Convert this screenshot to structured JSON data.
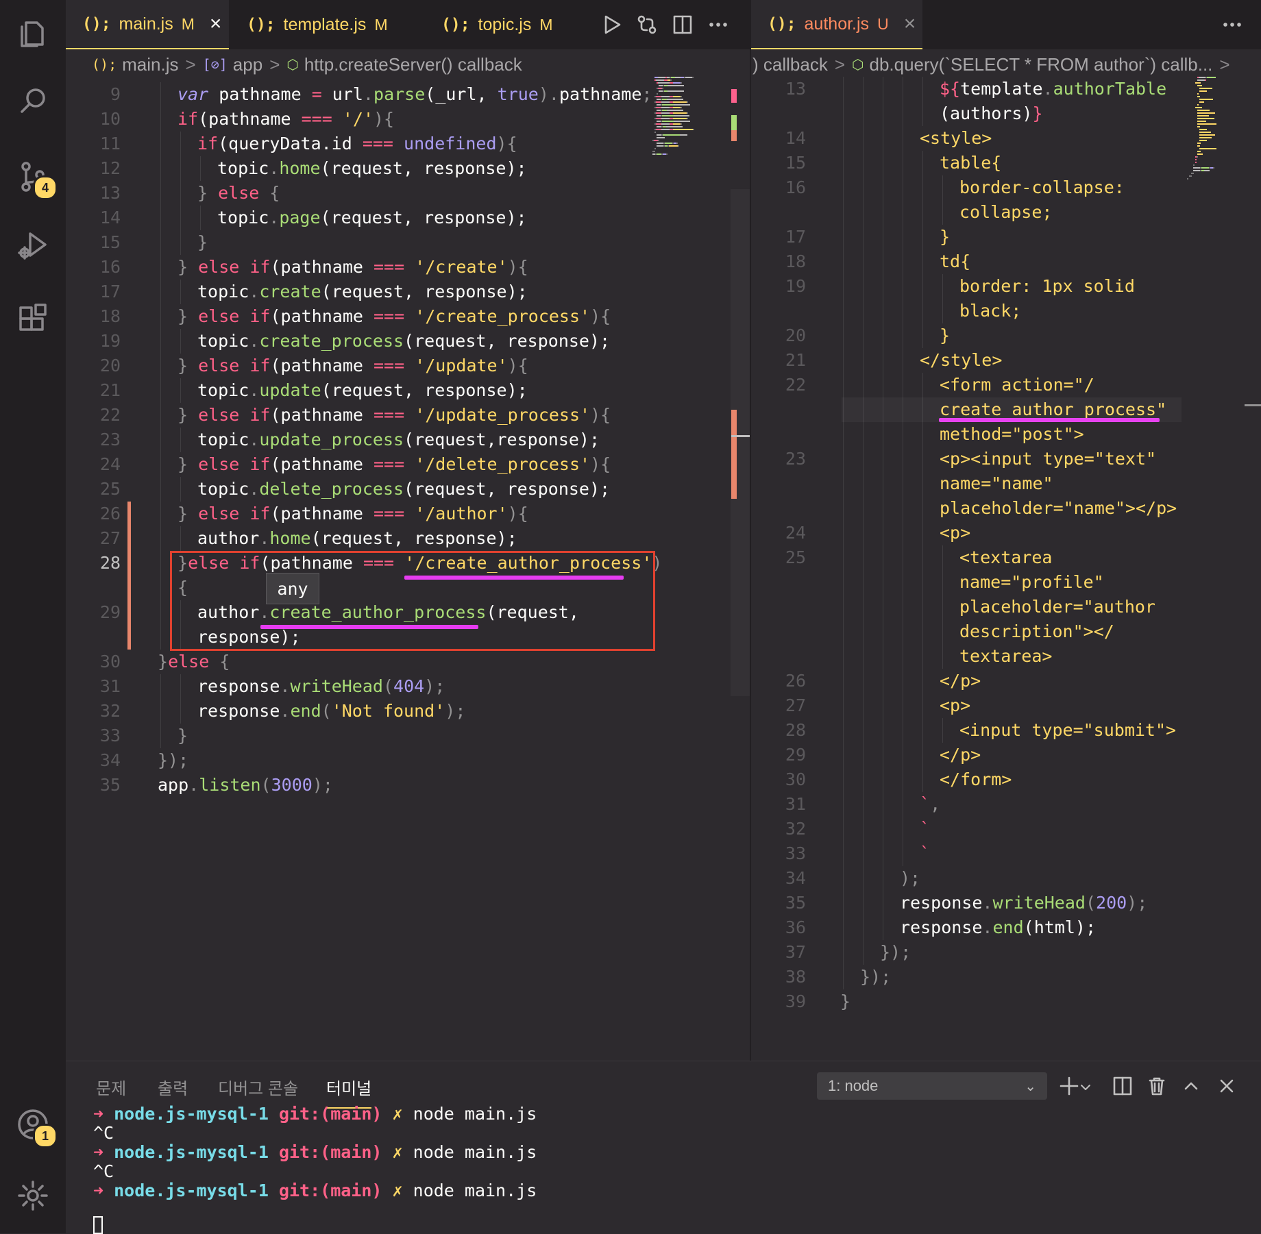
{
  "activity_bar": {
    "source_control_badge": "4",
    "accounts_badge": "1"
  },
  "left_editor": {
    "tabs": [
      {
        "icon": "(); ",
        "name": "main.js",
        "status": "M",
        "active": true
      },
      {
        "icon": "(); ",
        "name": "template.js",
        "status": "M",
        "active": false
      },
      {
        "icon": "(); ",
        "name": "topic.js",
        "status": "M",
        "active": false
      }
    ],
    "breadcrumb": {
      "file": "main.js",
      "variable": "app",
      "function": "http.createServer() callback"
    },
    "hover_tooltip": "any",
    "lines": [
      {
        "n": "9",
        "segs": [
          [
            "var ",
            "i"
          ],
          [
            "pathname ",
            "v"
          ],
          [
            "= ",
            "k"
          ],
          [
            "url",
            "v"
          ],
          [
            ".",
            "p"
          ],
          [
            "parse",
            "f"
          ],
          [
            "(_url, ",
            "v"
          ],
          [
            "true",
            "n"
          ],
          [
            ").",
            "p"
          ],
          [
            "pathname",
            "v"
          ],
          [
            ";",
            "p"
          ]
        ],
        "indent": 1
      },
      {
        "n": "10",
        "segs": [
          [
            "if",
            "k"
          ],
          [
            "(pathname ",
            "v"
          ],
          [
            "=== ",
            "k"
          ],
          [
            "'/'",
            "s"
          ],
          [
            "){",
            "p"
          ]
        ],
        "indent": 1
      },
      {
        "n": "11",
        "segs": [
          [
            "if",
            "k"
          ],
          [
            "(queryData.id ",
            "v"
          ],
          [
            "=== ",
            "k"
          ],
          [
            "undefined",
            "n"
          ],
          [
            "){",
            "p"
          ]
        ],
        "indent": 2
      },
      {
        "n": "12",
        "segs": [
          [
            "topic",
            "v"
          ],
          [
            ".",
            "p"
          ],
          [
            "home",
            "f"
          ],
          [
            "(request, response);",
            "v"
          ]
        ],
        "indent": 3
      },
      {
        "n": "13",
        "segs": [
          [
            "} ",
            "p"
          ],
          [
            "else ",
            "k"
          ],
          [
            "{",
            "p"
          ]
        ],
        "indent": 2
      },
      {
        "n": "14",
        "segs": [
          [
            "topic",
            "v"
          ],
          [
            ".",
            "p"
          ],
          [
            "page",
            "f"
          ],
          [
            "(request, response);",
            "v"
          ]
        ],
        "indent": 3
      },
      {
        "n": "15",
        "segs": [
          [
            "}",
            "p"
          ]
        ],
        "indent": 2
      },
      {
        "n": "16",
        "segs": [
          [
            "} ",
            "p"
          ],
          [
            "else if",
            "k"
          ],
          [
            "(pathname ",
            "v"
          ],
          [
            "=== ",
            "k"
          ],
          [
            "'/create'",
            "s"
          ],
          [
            "){",
            "p"
          ]
        ],
        "indent": 1
      },
      {
        "n": "17",
        "segs": [
          [
            "topic",
            "v"
          ],
          [
            ".",
            "p"
          ],
          [
            "create",
            "f"
          ],
          [
            "(request, response);",
            "v"
          ]
        ],
        "indent": 2
      },
      {
        "n": "18",
        "segs": [
          [
            "} ",
            "p"
          ],
          [
            "else if",
            "k"
          ],
          [
            "(pathname ",
            "v"
          ],
          [
            "=== ",
            "k"
          ],
          [
            "'/create_process'",
            "s"
          ],
          [
            "){",
            "p"
          ]
        ],
        "indent": 1
      },
      {
        "n": "19",
        "segs": [
          [
            "topic",
            "v"
          ],
          [
            ".",
            "p"
          ],
          [
            "create_process",
            "f"
          ],
          [
            "(request, response);",
            "v"
          ]
        ],
        "indent": 2
      },
      {
        "n": "20",
        "segs": [
          [
            "} ",
            "p"
          ],
          [
            "else if",
            "k"
          ],
          [
            "(pathname ",
            "v"
          ],
          [
            "=== ",
            "k"
          ],
          [
            "'/update'",
            "s"
          ],
          [
            "){",
            "p"
          ]
        ],
        "indent": 1
      },
      {
        "n": "21",
        "segs": [
          [
            "topic",
            "v"
          ],
          [
            ".",
            "p"
          ],
          [
            "update",
            "f"
          ],
          [
            "(request, response);",
            "v"
          ]
        ],
        "indent": 2
      },
      {
        "n": "22",
        "segs": [
          [
            "} ",
            "p"
          ],
          [
            "else if",
            "k"
          ],
          [
            "(pathname ",
            "v"
          ],
          [
            "=== ",
            "k"
          ],
          [
            "'/update_process'",
            "s"
          ],
          [
            "){",
            "p"
          ]
        ],
        "indent": 1
      },
      {
        "n": "23",
        "segs": [
          [
            "topic",
            "v"
          ],
          [
            ".",
            "p"
          ],
          [
            "update_process",
            "f"
          ],
          [
            "(request,response);",
            "v"
          ]
        ],
        "indent": 2
      },
      {
        "n": "24",
        "segs": [
          [
            "} ",
            "p"
          ],
          [
            "else if",
            "k"
          ],
          [
            "(pathname ",
            "v"
          ],
          [
            "=== ",
            "k"
          ],
          [
            "'/delete_process'",
            "s"
          ],
          [
            "){",
            "p"
          ]
        ],
        "indent": 1
      },
      {
        "n": "25",
        "segs": [
          [
            "topic",
            "v"
          ],
          [
            ".",
            "p"
          ],
          [
            "delete_process",
            "f"
          ],
          [
            "(request, response);",
            "v"
          ]
        ],
        "indent": 2
      },
      {
        "n": "26",
        "segs": [
          [
            "} ",
            "p"
          ],
          [
            "else if",
            "k"
          ],
          [
            "(pathname ",
            "v"
          ],
          [
            "=== ",
            "k"
          ],
          [
            "'/author'",
            "s"
          ],
          [
            "){",
            "p"
          ]
        ],
        "indent": 1
      },
      {
        "n": "27",
        "segs": [
          [
            "author",
            "v"
          ],
          [
            ".",
            "p"
          ],
          [
            "home",
            "f"
          ],
          [
            "(request, response);",
            "v"
          ]
        ],
        "indent": 2
      },
      {
        "n": "28",
        "segs": [
          [
            "}",
            "p"
          ],
          [
            "else if",
            "k"
          ],
          [
            "(pathname ",
            "v"
          ],
          [
            "=== ",
            "k"
          ],
          [
            "'/create_author_process'",
            "s"
          ],
          [
            ")",
            "p"
          ]
        ],
        "indent": 1,
        "current": true
      },
      {
        "n": "",
        "segs": [
          [
            "{",
            "p"
          ]
        ],
        "indent": 1
      },
      {
        "n": "29",
        "segs": [
          [
            "author",
            "v"
          ],
          [
            ".",
            "p"
          ],
          [
            "create_author_process",
            "f"
          ],
          [
            "(request,",
            "v"
          ]
        ],
        "indent": 2
      },
      {
        "n": "",
        "segs": [
          [
            "response);",
            "v"
          ]
        ],
        "indent": 2
      },
      {
        "n": "30",
        "segs": [
          [
            "}",
            "p"
          ],
          [
            "else ",
            "k"
          ],
          [
            "{",
            "p"
          ]
        ],
        "indent": 0
      },
      {
        "n": "31",
        "segs": [
          [
            "response",
            "v"
          ],
          [
            ".",
            "p"
          ],
          [
            "writeHead",
            "f"
          ],
          [
            "(",
            "p"
          ],
          [
            "404",
            "n"
          ],
          [
            ");",
            "p"
          ]
        ],
        "indent": 2
      },
      {
        "n": "32",
        "segs": [
          [
            "response",
            "v"
          ],
          [
            ".",
            "p"
          ],
          [
            "end",
            "f"
          ],
          [
            "(",
            "p"
          ],
          [
            "'Not found'",
            "s"
          ],
          [
            ");",
            "p"
          ]
        ],
        "indent": 2
      },
      {
        "n": "33",
        "segs": [
          [
            "}",
            "p"
          ]
        ],
        "indent": 1
      },
      {
        "n": "34",
        "segs": [
          [
            "});",
            "p"
          ]
        ],
        "indent": 0
      },
      {
        "n": "35",
        "segs": [
          [
            "app",
            "v"
          ],
          [
            ".",
            "p"
          ],
          [
            "listen",
            "f"
          ],
          [
            "(",
            "p"
          ],
          [
            "3000",
            "n"
          ],
          [
            ");",
            "p"
          ]
        ],
        "indent": 0
      }
    ]
  },
  "right_editor": {
    "tab": {
      "icon": "(); ",
      "name": "author.js",
      "status": "U"
    },
    "breadcrumb": {
      "part1": ") callback",
      "part2": "db.query(`SELECT * FROM author`) callb..."
    },
    "lines": [
      {
        "n": "13",
        "segs": [
          [
            "${",
            "t"
          ],
          [
            "template",
            "v"
          ],
          [
            ".",
            "p"
          ],
          [
            "authorTable",
            "f"
          ]
        ],
        "indent": 5
      },
      {
        "n": "",
        "segs": [
          [
            "(authors)",
            "v"
          ],
          [
            "}",
            "t"
          ]
        ],
        "indent": 5
      },
      {
        "n": "14",
        "segs": [
          [
            "<style>",
            "s"
          ]
        ],
        "indent": 4
      },
      {
        "n": "15",
        "segs": [
          [
            "table{",
            "s"
          ]
        ],
        "indent": 5
      },
      {
        "n": "16",
        "segs": [
          [
            "border-collapse:",
            "s"
          ]
        ],
        "indent": 6
      },
      {
        "n": "",
        "segs": [
          [
            "collapse;",
            "s"
          ]
        ],
        "indent": 6
      },
      {
        "n": "17",
        "segs": [
          [
            "}",
            "s"
          ]
        ],
        "indent": 5
      },
      {
        "n": "18",
        "segs": [
          [
            "td{",
            "s"
          ]
        ],
        "indent": 5
      },
      {
        "n": "19",
        "segs": [
          [
            "border: 1px solid",
            "s"
          ]
        ],
        "indent": 6
      },
      {
        "n": "",
        "segs": [
          [
            "black;",
            "s"
          ]
        ],
        "indent": 6
      },
      {
        "n": "20",
        "segs": [
          [
            "}",
            "s"
          ]
        ],
        "indent": 5
      },
      {
        "n": "21",
        "segs": [
          [
            "</style>",
            "s"
          ]
        ],
        "indent": 4
      },
      {
        "n": "22",
        "segs": [
          [
            "<form action=\"/",
            "s"
          ]
        ],
        "indent": 5
      },
      {
        "n": "",
        "segs": [
          [
            "create_author_process\"",
            "s"
          ]
        ],
        "indent": 5
      },
      {
        "n": "",
        "segs": [
          [
            "method=\"post\">",
            "s"
          ]
        ],
        "indent": 5
      },
      {
        "n": "23",
        "segs": [
          [
            "<p><input type=\"text\"",
            "s"
          ]
        ],
        "indent": 5
      },
      {
        "n": "",
        "segs": [
          [
            "name=\"name\"",
            "s"
          ]
        ],
        "indent": 5
      },
      {
        "n": "",
        "segs": [
          [
            "placeholder=\"name\"></p>",
            "s"
          ]
        ],
        "indent": 5
      },
      {
        "n": "24",
        "segs": [
          [
            "<p>",
            "s"
          ]
        ],
        "indent": 5
      },
      {
        "n": "25",
        "segs": [
          [
            "<textarea",
            "s"
          ]
        ],
        "indent": 6
      },
      {
        "n": "",
        "segs": [
          [
            "name=\"profile\"",
            "s"
          ]
        ],
        "indent": 6
      },
      {
        "n": "",
        "segs": [
          [
            "placeholder=\"author",
            "s"
          ]
        ],
        "indent": 6
      },
      {
        "n": "",
        "segs": [
          [
            "description\"></",
            "s"
          ]
        ],
        "indent": 6
      },
      {
        "n": "",
        "segs": [
          [
            "textarea>",
            "s"
          ]
        ],
        "indent": 6
      },
      {
        "n": "26",
        "segs": [
          [
            "</p>",
            "s"
          ]
        ],
        "indent": 5
      },
      {
        "n": "27",
        "segs": [
          [
            "<p>",
            "s"
          ]
        ],
        "indent": 5
      },
      {
        "n": "28",
        "segs": [
          [
            "<input type=\"submit\">",
            "s"
          ]
        ],
        "indent": 6
      },
      {
        "n": "29",
        "segs": [
          [
            "</p>",
            "s"
          ]
        ],
        "indent": 5
      },
      {
        "n": "30",
        "segs": [
          [
            "</form>",
            "s"
          ]
        ],
        "indent": 5
      },
      {
        "n": "31",
        "segs": [
          [
            "`",
            "t"
          ],
          [
            ",",
            "p"
          ]
        ],
        "indent": 4
      },
      {
        "n": "32",
        "segs": [
          [
            "`",
            "t"
          ]
        ],
        "indent": 4
      },
      {
        "n": "33",
        "segs": [
          [
            "`",
            "t"
          ]
        ],
        "indent": 4
      },
      {
        "n": "34",
        "segs": [
          [
            ");",
            "p"
          ]
        ],
        "indent": 3
      },
      {
        "n": "35",
        "segs": [
          [
            "response",
            "v"
          ],
          [
            ".",
            "p"
          ],
          [
            "writeHead",
            "f"
          ],
          [
            "(",
            "p"
          ],
          [
            "200",
            "n"
          ],
          [
            ");",
            "p"
          ]
        ],
        "indent": 3
      },
      {
        "n": "36",
        "segs": [
          [
            "response",
            "v"
          ],
          [
            ".",
            "p"
          ],
          [
            "end",
            "f"
          ],
          [
            "(html);",
            "v"
          ]
        ],
        "indent": 3
      },
      {
        "n": "37",
        "segs": [
          [
            "});",
            "p"
          ]
        ],
        "indent": 2
      },
      {
        "n": "38",
        "segs": [
          [
            "});",
            "p"
          ]
        ],
        "indent": 1
      },
      {
        "n": "39",
        "segs": [
          [
            "}",
            "p"
          ]
        ],
        "indent": 0
      }
    ]
  },
  "panel": {
    "tabs": [
      "문제",
      "출력",
      "디버그 콘솔",
      "터미널"
    ],
    "active_tab": "터미널",
    "terminal_select": "1: node",
    "terminal_lines": [
      {
        "prompt": "➜",
        "dir": "node.js-mysql-1",
        "git": "git:(",
        "branch": "main",
        "close": ")",
        "mark": "✗",
        "cmd": "node main.js"
      },
      {
        "plain": "^C"
      },
      {
        "prompt": "➜",
        "dir": "node.js-mysql-1",
        "git": "git:(",
        "branch": "main",
        "close": ")",
        "mark": "✗",
        "cmd": "node main.js"
      },
      {
        "plain": "^C"
      },
      {
        "prompt": "➜",
        "dir": "node.js-mysql-1",
        "git": "git:(",
        "branch": "main",
        "close": ")",
        "mark": "✗",
        "cmd": "node main.js"
      }
    ]
  },
  "colors": {
    "keyword": "#ff6188",
    "function": "#a9dc76",
    "string": "#ffd866",
    "number": "#ab9df2",
    "highlight_box": "#e0412f",
    "underline": "#e63cf0",
    "terminal_dir": "#78dce8"
  }
}
